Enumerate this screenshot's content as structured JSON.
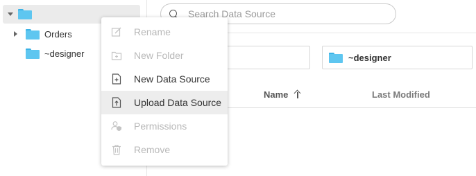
{
  "tree": {
    "root_label": "",
    "children": [
      {
        "label": "Orders",
        "expandable": true
      },
      {
        "label": "~designer",
        "expandable": false
      }
    ]
  },
  "search": {
    "placeholder": "Search Data Source",
    "value": ""
  },
  "breadcrumb": {
    "current_folder": "~designer"
  },
  "table": {
    "columns": [
      {
        "label": "Name",
        "sort": "ascending"
      },
      {
        "label": "Last Modified"
      }
    ],
    "rows": []
  },
  "context_menu": {
    "items": [
      {
        "label": "Rename",
        "icon": "edit-icon",
        "enabled": false
      },
      {
        "label": "New Folder",
        "icon": "new-folder-icon",
        "enabled": false
      },
      {
        "label": "New Data Source",
        "icon": "new-document-icon",
        "enabled": true
      },
      {
        "label": "Upload Data Source",
        "icon": "upload-document-icon",
        "enabled": true,
        "highlighted": true
      },
      {
        "label": "Permissions",
        "icon": "user-shield-icon",
        "enabled": false
      },
      {
        "label": "Remove",
        "icon": "trash-icon",
        "enabled": false
      }
    ]
  },
  "colors": {
    "folder": "#5ec6f0",
    "folder_tab": "#3ab2e6",
    "disabled_text": "#b8b8b8",
    "highlight_bg": "#ededed"
  }
}
